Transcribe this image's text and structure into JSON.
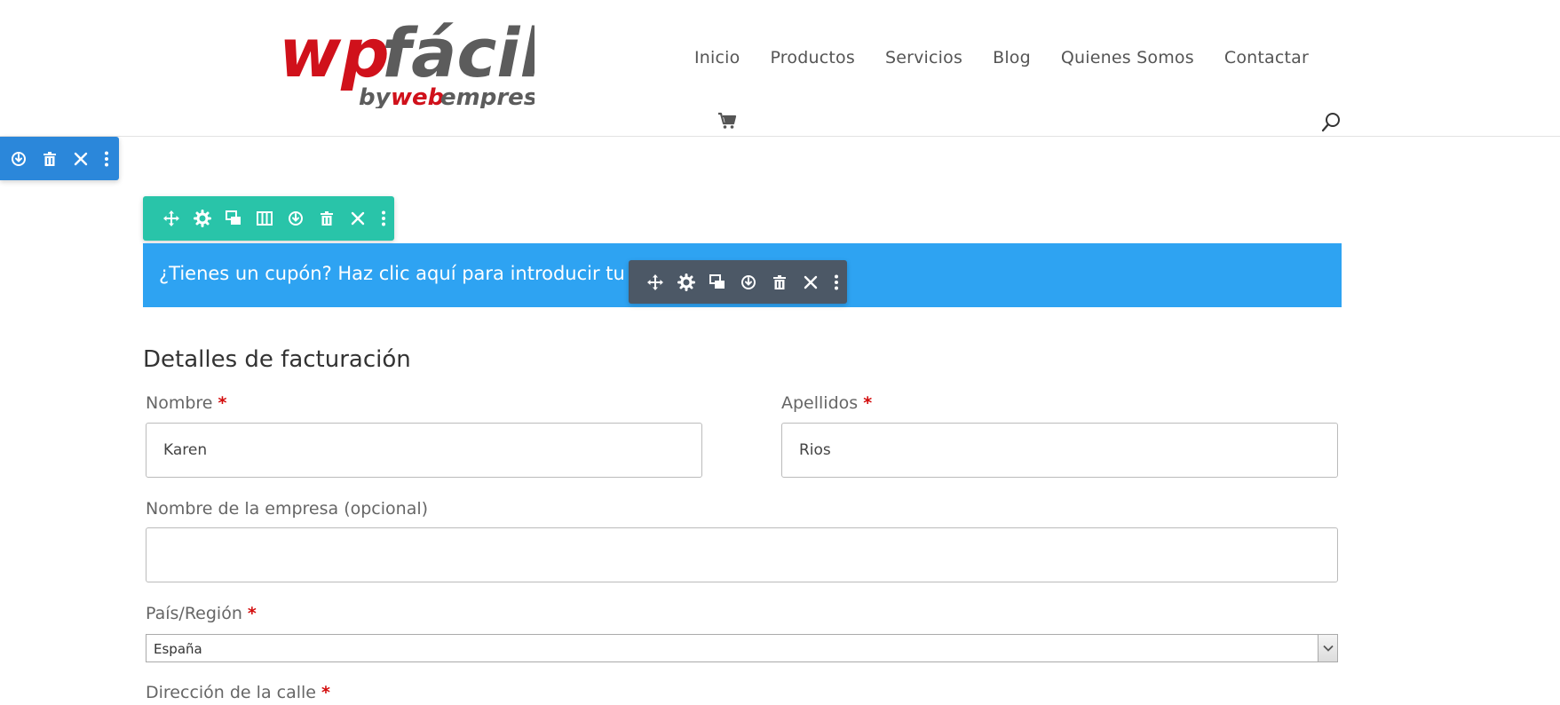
{
  "logo": {
    "text_wp": "wp",
    "text_facil": "fácil",
    "text_by": "by",
    "text_web": "web",
    "text_empresa": "empresa"
  },
  "nav": {
    "items": [
      "Inicio",
      "Productos",
      "Servicios",
      "Blog",
      "Quienes Somos",
      "Contactar"
    ]
  },
  "icons": {
    "cart": "cart-icon",
    "search": "search-icon",
    "move": "move-icon",
    "settings": "gear-icon",
    "duplicate": "duplicate-icon",
    "columns": "columns-icon",
    "save": "save-icon",
    "delete": "trash-icon",
    "close": "close-icon",
    "more": "more-icon"
  },
  "coupon": {
    "text": "¿Tienes un cupón? Haz clic aquí para introducir tu código"
  },
  "billing": {
    "heading": "Detalles de facturación",
    "required_mark": "*",
    "first_name": {
      "label": "Nombre",
      "value": "Karen"
    },
    "last_name": {
      "label": "Apellidos",
      "value": "Rios"
    },
    "company": {
      "label": "Nombre de la empresa (opcional)",
      "value": ""
    },
    "country": {
      "label": "País/Región",
      "value": "España"
    },
    "street": {
      "label": "Dirección de la calle"
    }
  },
  "colors": {
    "section_toolbar": "#2b87da",
    "row_toolbar": "#29c4a9",
    "module_toolbar": "#4c5866",
    "coupon_bg": "#2ea3f2",
    "required": "#d30c0c",
    "logo_red": "#d0111b",
    "logo_gray": "#5c5c5c"
  }
}
